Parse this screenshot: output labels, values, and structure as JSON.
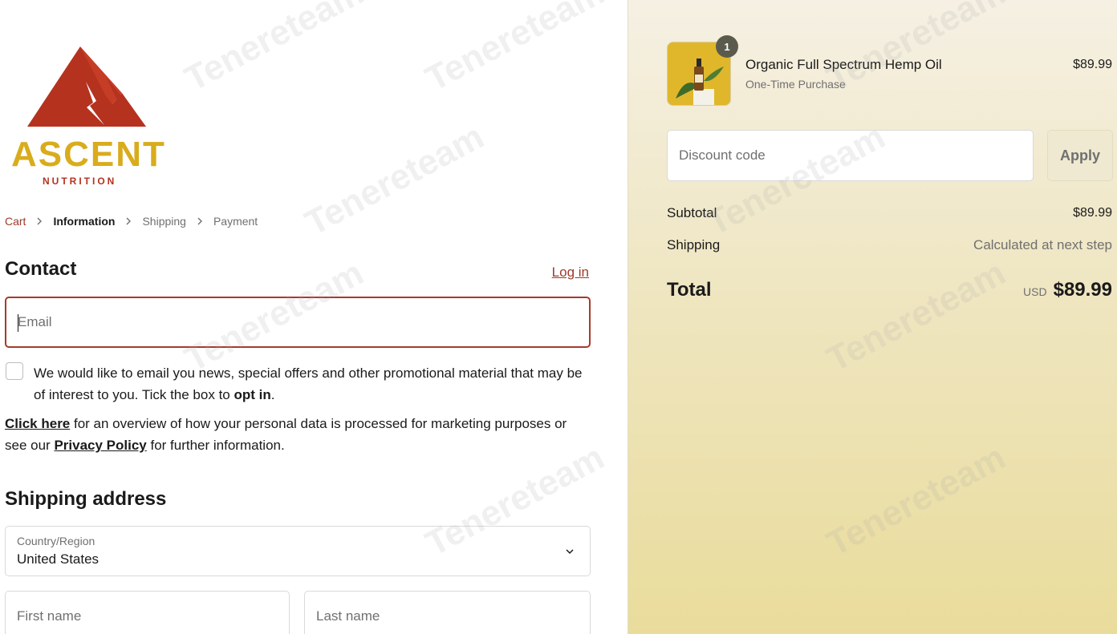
{
  "brand": {
    "name": "ASCENT",
    "subname": "NUTRITION",
    "red": "#b5321f",
    "gold": "#d9ac1d"
  },
  "breadcrumb": [
    "Cart",
    "Information",
    "Shipping",
    "Payment"
  ],
  "contact": {
    "title": "Contact",
    "login_label": "Log in",
    "email_placeholder": "Email",
    "optin_text_before": "We would like to email you news, special offers and other promotional material that may be of interest to you. Tick the box to ",
    "optin_bold": "opt in",
    "optin_text_after": ".",
    "privacy_link1": "Click here",
    "privacy_text1": " for an overview of how your personal data is processed for marketing purposes or see our ",
    "privacy_link2": "Privacy Policy",
    "privacy_text2": " for further information."
  },
  "shipping": {
    "title": "Shipping address",
    "country_label": "Country/Region",
    "country_value": "United States",
    "first_name_placeholder": "First name",
    "last_name_placeholder": "Last name"
  },
  "order": {
    "item": {
      "name": "Organic Full Spectrum Hemp Oil",
      "variant": "One-Time Purchase",
      "price": "$89.99",
      "quantity": "1"
    },
    "discount_placeholder": "Discount code",
    "apply_label": "Apply",
    "subtotal_label": "Subtotal",
    "subtotal_value": "$89.99",
    "shipping_label": "Shipping",
    "shipping_value": "Calculated at next step",
    "total_label": "Total",
    "currency": "USD",
    "total_value": "$89.99"
  },
  "watermark": "Tenereteam",
  "colors": {
    "accent": "#a73a2b",
    "link": "#9d3b2a"
  }
}
